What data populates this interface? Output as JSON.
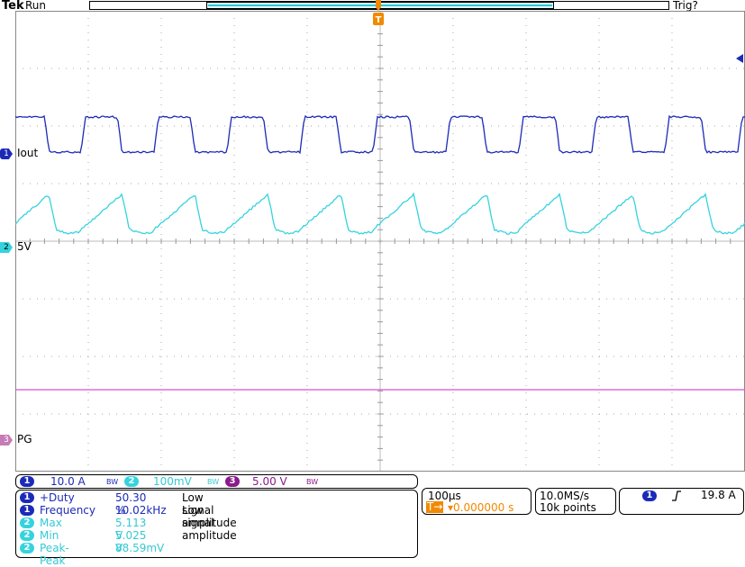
{
  "header": {
    "brand": "Tek",
    "status": "Run",
    "trigger_status": "Trig?"
  },
  "channels": [
    {
      "id": "1",
      "label": "Iout",
      "color": "#1c2ab8"
    },
    {
      "id": "2",
      "label": "5V",
      "color": "#35d3de"
    },
    {
      "id": "3",
      "label": "PG",
      "color": "#c03ac0"
    }
  ],
  "scales": {
    "ch1": "10.0 A",
    "ch2": "100mV",
    "ch3": "5.00 V",
    "bw_mark": "BW"
  },
  "measurements": [
    {
      "ch": "1",
      "name": "+Duty",
      "value": "50.30 %",
      "note": "Low signal amplitude"
    },
    {
      "ch": "1",
      "name": "Frequency",
      "value": "10.02kHz",
      "note": "Low signal amplitude"
    },
    {
      "ch": "2",
      "name": "Max",
      "value": "5.113 V",
      "note": ""
    },
    {
      "ch": "2",
      "name": "Min",
      "value": "5.025 V",
      "note": ""
    },
    {
      "ch": "2",
      "name": "Peak-Peak",
      "value": "88.59mV",
      "note": ""
    }
  ],
  "timebase": {
    "per_div": "100µs",
    "trigger_pos": "▾0.000000 s",
    "trigger_icon": "T→"
  },
  "acquisition": {
    "rate": "10.0MS/s",
    "points": "10k points"
  },
  "trigger": {
    "source": "1",
    "slope_icon": "rising-edge-icon",
    "level": "19.8 A"
  }
}
